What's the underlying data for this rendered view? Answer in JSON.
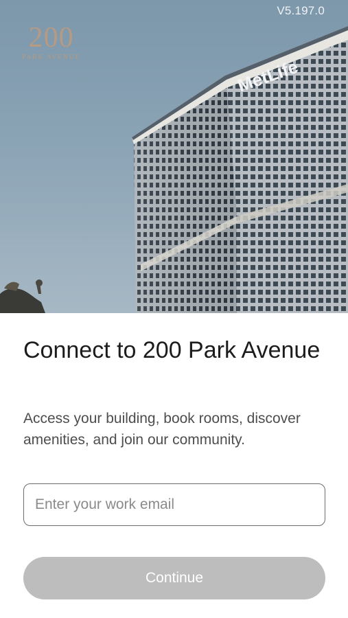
{
  "header": {
    "version": "V5.197.0",
    "logo": {
      "number": "200",
      "subtitle": "PARK AVENUE"
    },
    "building_sign": "MetLife"
  },
  "main": {
    "title": "Connect to 200 Park Avenue",
    "subtitle": "Access your building, book rooms, discover amenities, and join our community.",
    "email_placeholder": "Enter your work email",
    "email_value": "",
    "continue_label": "Continue"
  },
  "colors": {
    "logo": "#b59a84",
    "button_disabled": "#bdbdbd",
    "sky": "#8aa3b5"
  }
}
